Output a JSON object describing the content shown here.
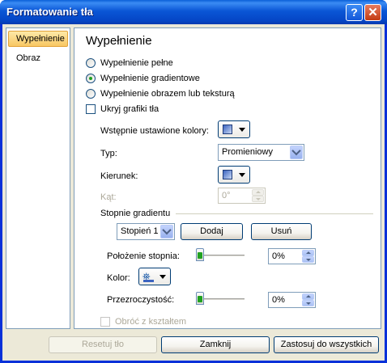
{
  "window": {
    "title": "Formatowanie tła",
    "help_label": "?",
    "close_label": "✕"
  },
  "sidebar": {
    "items": [
      {
        "label": "Wypełnienie",
        "active": true
      },
      {
        "label": "Obraz",
        "active": false
      }
    ]
  },
  "panel": {
    "heading": "Wypełnienie",
    "fill_options": [
      {
        "label": "Wypełnienie pełne",
        "selected": false
      },
      {
        "label": "Wypełnienie gradientowe",
        "selected": true
      },
      {
        "label": "Wypełnienie obrazem lub teksturą",
        "selected": false
      }
    ],
    "hide_graphics": {
      "label": "Ukryj grafiki tła",
      "checked": false
    },
    "preset_colors_label": "Wstępnie ustawione kolory:",
    "type_label": "Typ:",
    "type_value": "Promieniowy",
    "direction_label": "Kierunek:",
    "angle_label": "Kąt:",
    "angle_value": "0°",
    "gradient_stops_label": "Stopnie gradientu",
    "stop_value": "Stopień 1",
    "add_button": "Dodaj",
    "remove_button": "Usuń",
    "position_label": "Położenie stopnia:",
    "position_value": "0%",
    "color_label": "Kolor:",
    "transparency_label": "Przezroczystość:",
    "transparency_value": "0%",
    "rotate_label": "Obróć z kształtem",
    "position_level": 0,
    "transparency_level": 0
  },
  "footer": {
    "reset_button": "Resetuj tło",
    "close_button": "Zamknij",
    "apply_all_button": "Zastosuj do wszystkich"
  },
  "colors": {
    "title_bar": "#0a56d6",
    "dialog_bg": "#ece9d8",
    "accent_radio": "#21a121",
    "active_tab": "#f8c763"
  }
}
